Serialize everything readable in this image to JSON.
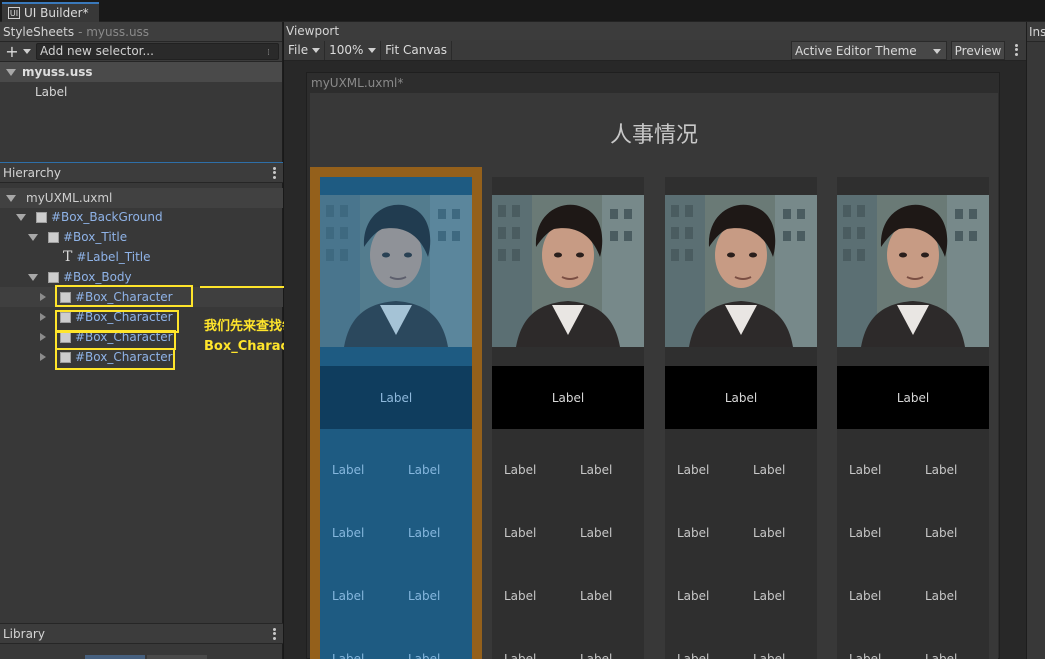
{
  "tab": {
    "title": "UI Builder*"
  },
  "stylesheets": {
    "header": "StyleSheets",
    "subtitle": "- myuss.uss",
    "selector_placeholder": "Add new selector...",
    "file": "myuss.uss",
    "items": [
      "Label"
    ]
  },
  "hierarchy": {
    "header": "Hierarchy",
    "root": "myUXML.uxml",
    "nodes": {
      "background": "#Box_BackGround",
      "title": "#Box_Title",
      "label_title": "#Label_Title",
      "body": "#Box_Body",
      "characters": [
        "#Box_Character",
        "#Box_Character",
        "#Box_Character",
        "#Box_Character"
      ]
    }
  },
  "annotation": {
    "line1": "我们先来查找每一个",
    "line2": "Box_Character 节点"
  },
  "library": {
    "header": "Library"
  },
  "viewport": {
    "header": "Viewport",
    "file_menu": "File",
    "zoom": "100%",
    "fit_canvas": "Fit Canvas",
    "theme": "Active Editor Theme",
    "preview": "Preview",
    "canvas_title": "myUXML.uxml*",
    "page_title": "人事情况",
    "cards": [
      {
        "name_label": "Label",
        "attrs": [
          "Label",
          "Label",
          "Label",
          "Label",
          "Label",
          "Label",
          "Label",
          "Label"
        ]
      },
      {
        "name_label": "Label",
        "attrs": [
          "Label",
          "Label",
          "Label",
          "Label",
          "Label",
          "Label",
          "Label",
          "Label"
        ]
      },
      {
        "name_label": "Label",
        "attrs": [
          "Label",
          "Label",
          "Label",
          "Label",
          "Label",
          "Label",
          "Label",
          "Label"
        ]
      },
      {
        "name_label": "Label",
        "attrs": [
          "Label",
          "Label",
          "Label",
          "Label",
          "Label",
          "Label",
          "Label",
          "Label"
        ]
      }
    ]
  },
  "inspector": {
    "header": "Ins"
  },
  "colors": {
    "accent_blue": "#3a79bb",
    "highlight_orange": "#94601b",
    "annotation_yellow": "#ffe52b",
    "selected_card": "#1e5b82"
  }
}
